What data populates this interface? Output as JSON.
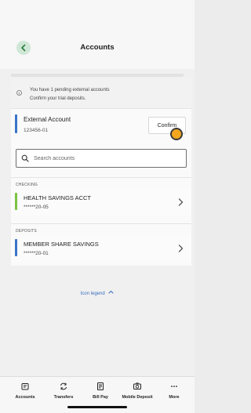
{
  "header": {
    "title": "Accounts"
  },
  "notice": {
    "line1": "You have 1 pending external accounts",
    "line2": "Confirm your trial deposits."
  },
  "external_account": {
    "name": "External Account",
    "number": "123456-01",
    "confirm_label": "Confirm"
  },
  "search": {
    "placeholder": "Search accounts"
  },
  "sections": {
    "checking": "CHECKING",
    "deposits": "DEPOSITS"
  },
  "accounts": [
    {
      "name": "HEALTH SAVINGS ACCT",
      "number": "******20-05",
      "color": "#7cc242"
    },
    {
      "name": "MEMBER SHARE SAVINGS",
      "number": "******20-01",
      "color": "#3b73c8"
    }
  ],
  "legend": {
    "label": "Icon legend"
  },
  "tabbar": {
    "items": [
      {
        "label": "Accounts",
        "icon": "accounts-icon"
      },
      {
        "label": "Transfers",
        "icon": "transfers-icon"
      },
      {
        "label": "Bill Pay",
        "icon": "bill-pay-icon"
      },
      {
        "label": "Mobile Deposit",
        "icon": "camera-icon"
      },
      {
        "label": "More",
        "icon": "more-icon"
      }
    ]
  },
  "colors": {
    "accent_green": "#7cc242",
    "accent_blue": "#3b73c8",
    "back_button": "#cfe7d6",
    "cursor": "#f4a71d"
  }
}
